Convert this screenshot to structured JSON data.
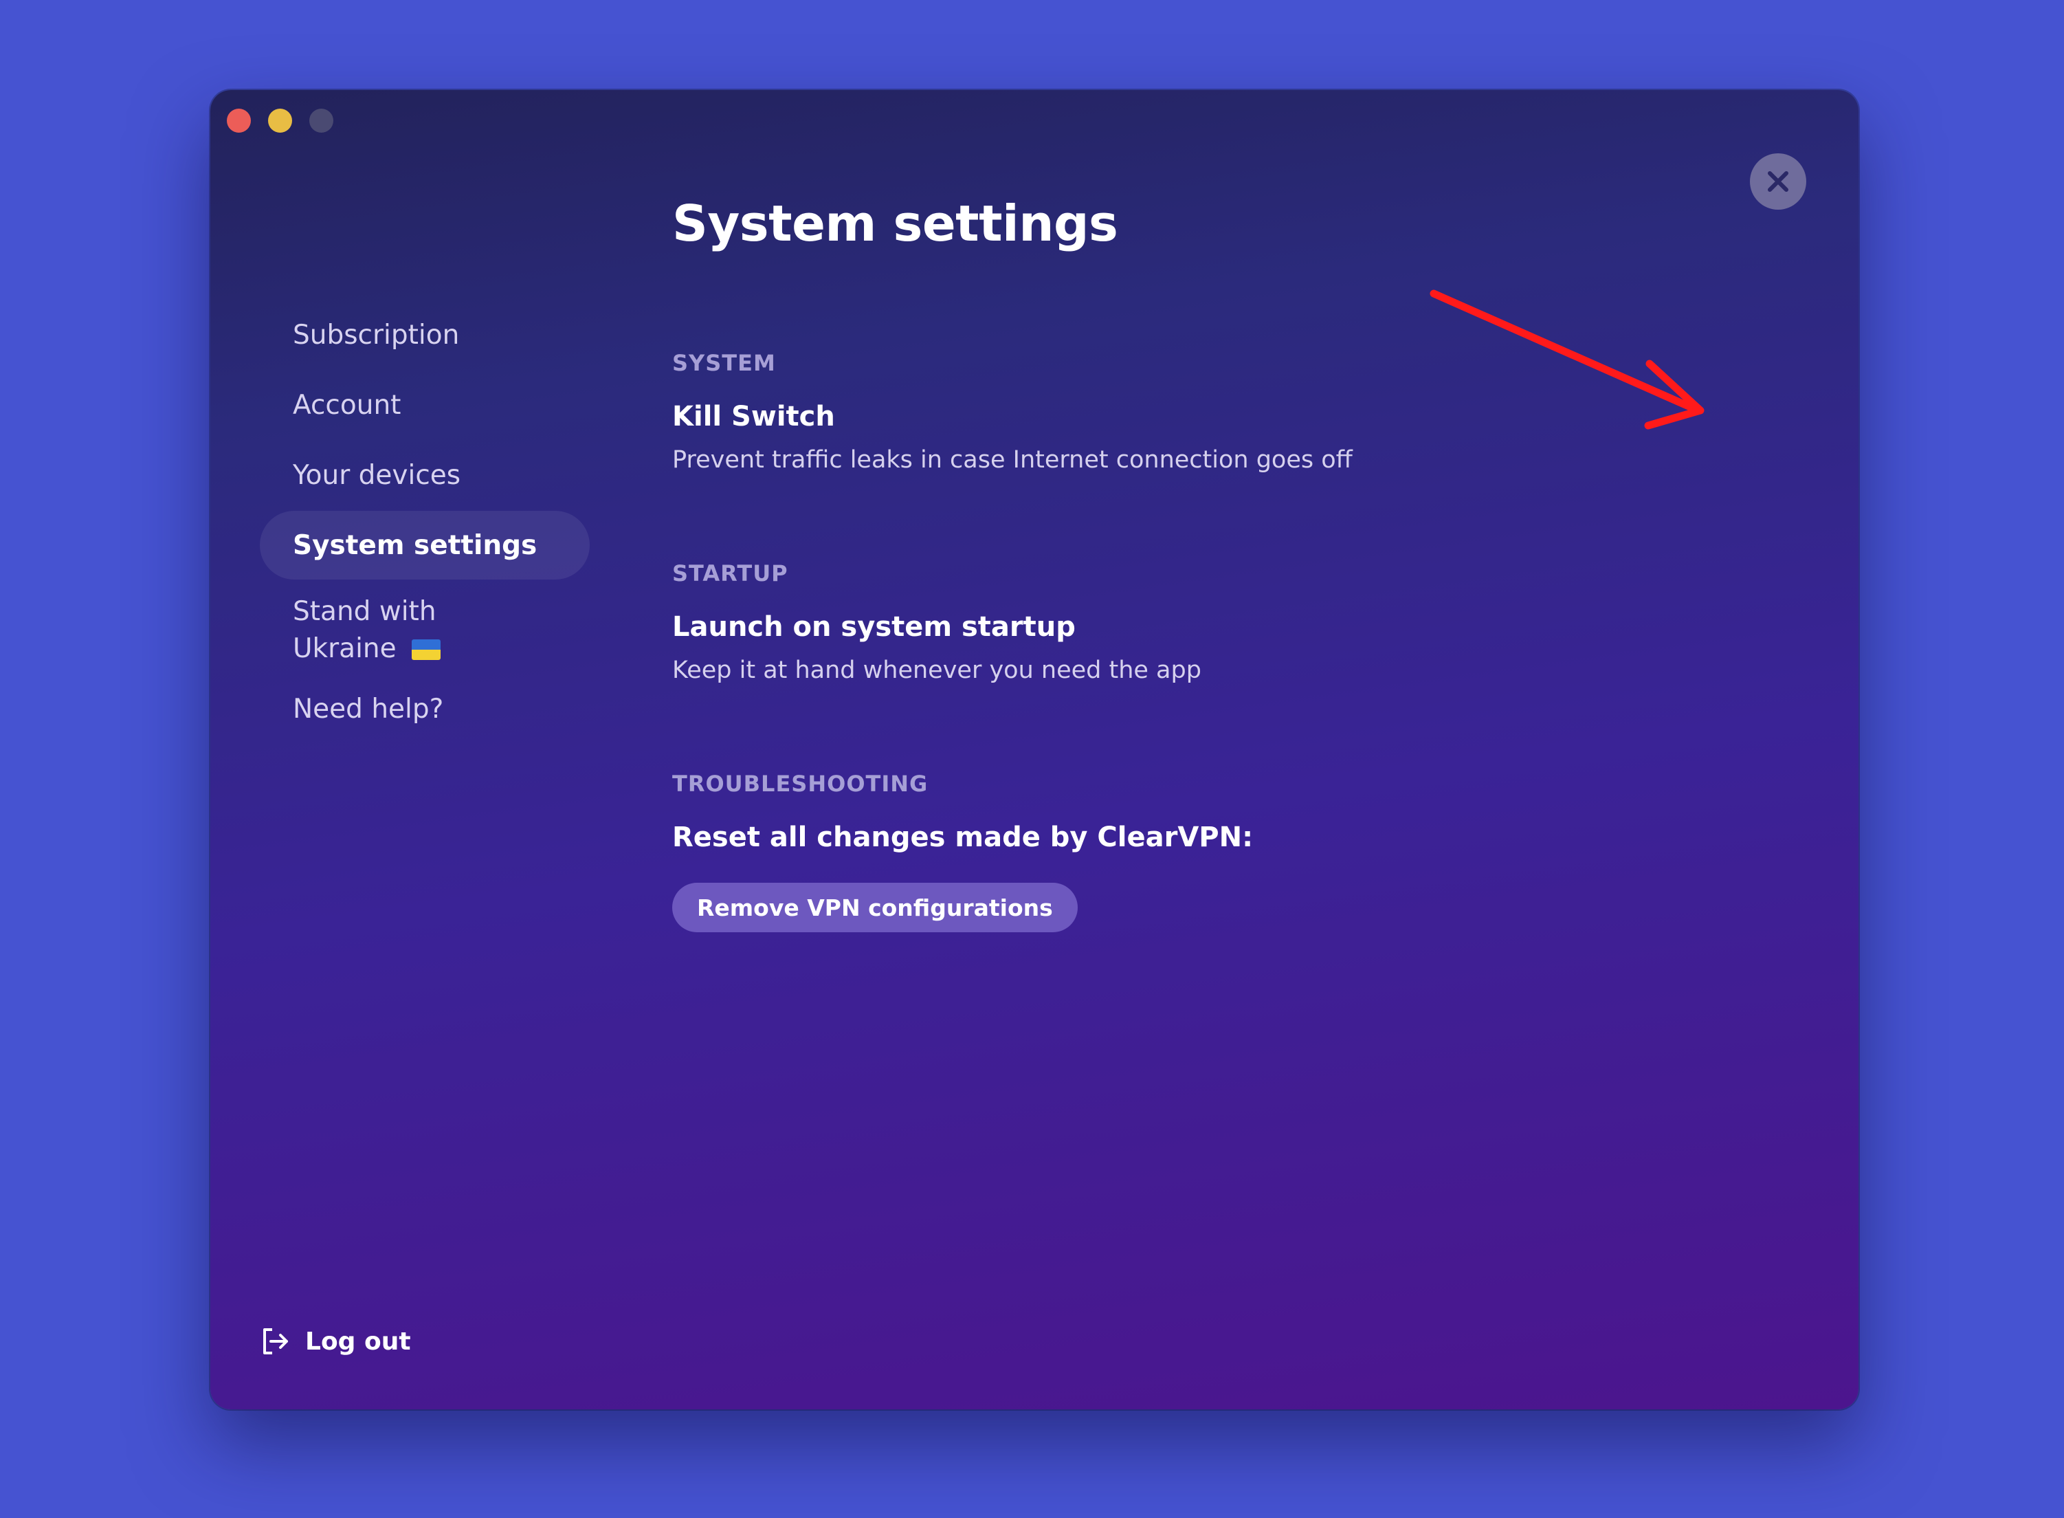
{
  "window": {
    "controls": [
      "close",
      "minimize",
      "zoom"
    ]
  },
  "sidebar": {
    "items": [
      {
        "label": "Subscription",
        "active": false
      },
      {
        "label": "Account",
        "active": false
      },
      {
        "label": "Your devices",
        "active": false
      },
      {
        "label": "System settings",
        "active": true
      },
      {
        "label": "Stand with Ukraine",
        "active": false,
        "icon": "ukraine-flag-icon"
      },
      {
        "label": "Need help?",
        "active": false
      }
    ],
    "logout_label": "Log out",
    "logout_icon": "logout-icon"
  },
  "main": {
    "title": "System settings",
    "close_icon": "close-icon",
    "sections": {
      "system": {
        "label": "SYSTEM",
        "title": "Kill Switch",
        "description": "Prevent traffic leaks in case Internet connection goes off",
        "toggle_on": true
      },
      "startup": {
        "label": "STARTUP",
        "title": "Launch on system startup",
        "description": "Keep it at hand whenever you need the app",
        "toggle_on": false
      },
      "troubleshooting": {
        "label": "TROUBLESHOOTING",
        "title": "Reset all changes made by ClearVPN:",
        "button_label": "Remove VPN configurations"
      }
    }
  },
  "annotation": {
    "type": "red-arrow",
    "color": "#ff1a1a",
    "target": "kill-switch-toggle"
  },
  "colors": {
    "background": "#4653d1",
    "toggle_on": "#d52f66",
    "button": "#6d58bf"
  }
}
